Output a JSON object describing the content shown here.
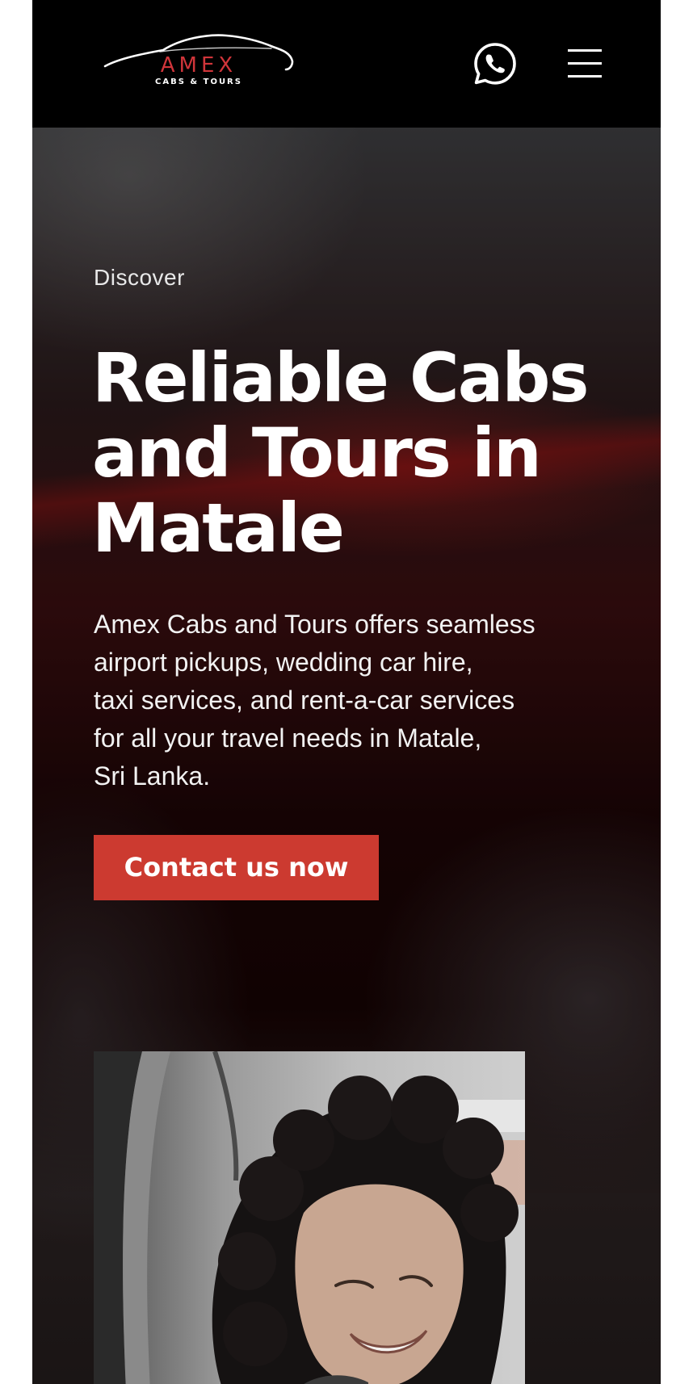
{
  "header": {
    "logo": {
      "name": "AMEX",
      "tagline": "CABS & TOURS"
    },
    "whatsapp_icon": "whatsapp-icon",
    "menu_icon": "hamburger-menu-icon"
  },
  "hero": {
    "eyebrow": "Discover",
    "headline_lines": [
      "Reliable Cabs",
      "and Tours in",
      "Matale"
    ],
    "description_lines": [
      "Amex Cabs and Tours offers seamless",
      "airport pickups, wedding car hire,",
      "taxi services, and rent-a-car services",
      "for all your travel needs in Matale,",
      "Sri Lanka."
    ],
    "cta_label": "Contact us now"
  },
  "colors": {
    "header_bg": "#000000",
    "brand_red": "#d0353a",
    "cta_bg": "#cc3a30",
    "text": "#ffffff"
  }
}
